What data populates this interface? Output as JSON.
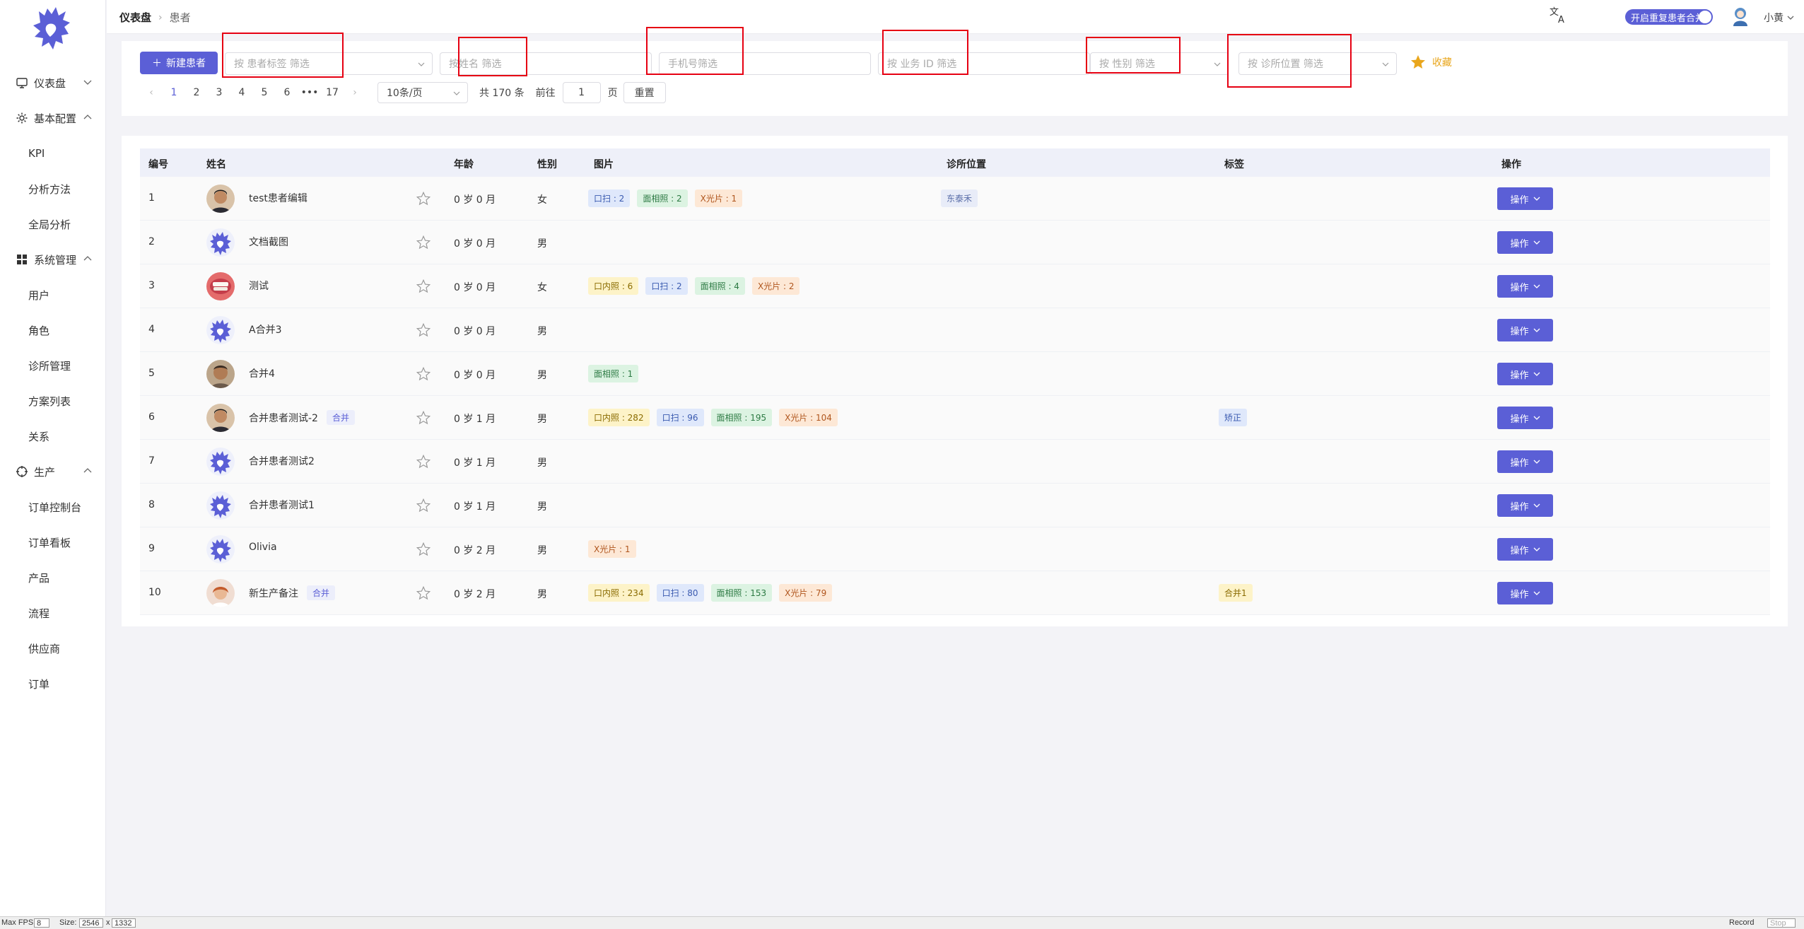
{
  "sidebar": {
    "items": [
      {
        "label": "仪表盘",
        "type": "group",
        "icon": "monitor-icon",
        "chevron": "down"
      },
      {
        "label": "基本配置",
        "type": "group",
        "icon": "gear-icon",
        "chevron": "up"
      },
      {
        "label": "KPI",
        "type": "sub"
      },
      {
        "label": "分析方法",
        "type": "sub"
      },
      {
        "label": "全局分析",
        "type": "sub"
      },
      {
        "label": "系统管理",
        "type": "group",
        "icon": "grid-icon",
        "chevron": "up"
      },
      {
        "label": "用户",
        "type": "sub"
      },
      {
        "label": "角色",
        "type": "sub"
      },
      {
        "label": "诊所管理",
        "type": "sub"
      },
      {
        "label": "方案列表",
        "type": "sub"
      },
      {
        "label": "关系",
        "type": "sub"
      },
      {
        "label": "生产",
        "type": "group",
        "icon": "target-icon",
        "chevron": "up"
      },
      {
        "label": "订单控制台",
        "type": "sub"
      },
      {
        "label": "订单看板",
        "type": "sub"
      },
      {
        "label": "产品",
        "type": "sub"
      },
      {
        "label": "流程",
        "type": "sub"
      },
      {
        "label": "供应商",
        "type": "sub"
      },
      {
        "label": "订单",
        "type": "sub"
      }
    ]
  },
  "header": {
    "breadcrumb": [
      "仪表盘",
      "患者"
    ],
    "merge_toggle_label": "开启重复患者合并",
    "user_name": "小黄"
  },
  "filters": {
    "new_button_label": "新建患者",
    "tag_placeholder": "按 患者标签 筛选",
    "name_placeholder": "按姓名 筛选",
    "phone_placeholder": "手机号筛选",
    "biz_id_placeholder": "按 业务 ID 筛选",
    "gender_placeholder": "按 性别 筛选",
    "clinic_placeholder": "按 诊所位置 筛选",
    "favorite_label": "收藏"
  },
  "pagination": {
    "pages": [
      "1",
      "2",
      "3",
      "4",
      "5",
      "6",
      "•••",
      "17"
    ],
    "current": "1",
    "page_size": "10条/页",
    "total": "共 170 条",
    "goto_label": "前往",
    "goto_value": "1",
    "page_unit": "页",
    "reset_label": "重置"
  },
  "table": {
    "columns": [
      "编号",
      "姓名",
      "年龄",
      "性别",
      "图片",
      "诊所位置",
      "标签",
      "操作"
    ],
    "op_label": "操作",
    "rows": [
      {
        "id": "1",
        "avatar": "photo-boy",
        "name": "test患者编辑",
        "merged": "",
        "age": "0 岁 0 月",
        "gender": "女",
        "images": [
          {
            "label": "口扫 : 2",
            "kind": "blue"
          },
          {
            "label": "面相照 : 2",
            "kind": "green"
          },
          {
            "label": "X光片 : 1",
            "kind": "orange"
          }
        ],
        "clinic": "东泰禾",
        "tag": ""
      },
      {
        "id": "2",
        "avatar": "logo",
        "name": "文档截图",
        "merged": "",
        "age": "0 岁 0 月",
        "gender": "男",
        "images": [],
        "clinic": "",
        "tag": ""
      },
      {
        "id": "3",
        "avatar": "photo-teeth",
        "name": "测试",
        "merged": "",
        "age": "0 岁 0 月",
        "gender": "女",
        "images": [
          {
            "label": "口内照 : 6",
            "kind": "yellow"
          },
          {
            "label": "口扫 : 2",
            "kind": "blue"
          },
          {
            "label": "面相照 : 4",
            "kind": "green"
          },
          {
            "label": "X光片 : 2",
            "kind": "orange"
          }
        ],
        "clinic": "",
        "tag": ""
      },
      {
        "id": "4",
        "avatar": "logo",
        "name": "A合并3",
        "merged": "",
        "age": "0 岁 0 月",
        "gender": "男",
        "images": [],
        "clinic": "",
        "tag": ""
      },
      {
        "id": "5",
        "avatar": "photo-man",
        "name": "合并4",
        "merged": "",
        "age": "0 岁 0 月",
        "gender": "男",
        "images": [
          {
            "label": "面相照 : 1",
            "kind": "green"
          }
        ],
        "clinic": "",
        "tag": ""
      },
      {
        "id": "6",
        "avatar": "photo-boy",
        "name": "合并患者测试-2",
        "merged": "合并",
        "age": "0 岁 1 月",
        "gender": "男",
        "images": [
          {
            "label": "口内照 : 282",
            "kind": "yellow"
          },
          {
            "label": "口扫 : 96",
            "kind": "blue"
          },
          {
            "label": "面相照 : 195",
            "kind": "green"
          },
          {
            "label": "X光片 : 104",
            "kind": "orange"
          }
        ],
        "clinic": "",
        "tag": "矫正",
        "tag_kind": "blue"
      },
      {
        "id": "7",
        "avatar": "logo",
        "name": "合并患者测试2",
        "merged": "",
        "age": "0 岁 1 月",
        "gender": "男",
        "images": [],
        "clinic": "",
        "tag": ""
      },
      {
        "id": "8",
        "avatar": "logo",
        "name": "合并患者测试1",
        "merged": "",
        "age": "0 岁 1 月",
        "gender": "男",
        "images": [],
        "clinic": "",
        "tag": ""
      },
      {
        "id": "9",
        "avatar": "logo",
        "name": "Olivia",
        "merged": "",
        "age": "0 岁 2 月",
        "gender": "男",
        "images": [
          {
            "label": "X光片 : 1",
            "kind": "orange"
          }
        ],
        "clinic": "",
        "tag": ""
      },
      {
        "id": "10",
        "avatar": "photo-girl",
        "name": "新生产备注",
        "merged": "合并",
        "age": "0 岁 2 月",
        "gender": "男",
        "images": [
          {
            "label": "口内照 : 234",
            "kind": "yellow"
          },
          {
            "label": "口扫 : 80",
            "kind": "blue"
          },
          {
            "label": "面相照 : 153",
            "kind": "green"
          },
          {
            "label": "X光片 : 79",
            "kind": "orange"
          }
        ],
        "clinic": "",
        "tag": "合并1",
        "tag_kind": "yellow"
      }
    ]
  },
  "statusbar": {
    "fps_label": "Max FPS:",
    "fps_value": "8",
    "size_label": "Size:",
    "width_value": "2546",
    "times": "x",
    "height_value": "1332",
    "record_label": "Record",
    "stop_label": "Stop"
  },
  "colors": {
    "accent": "#5b5fd6",
    "favorite": "#e9a61c",
    "highlight_box": "#e60012"
  }
}
